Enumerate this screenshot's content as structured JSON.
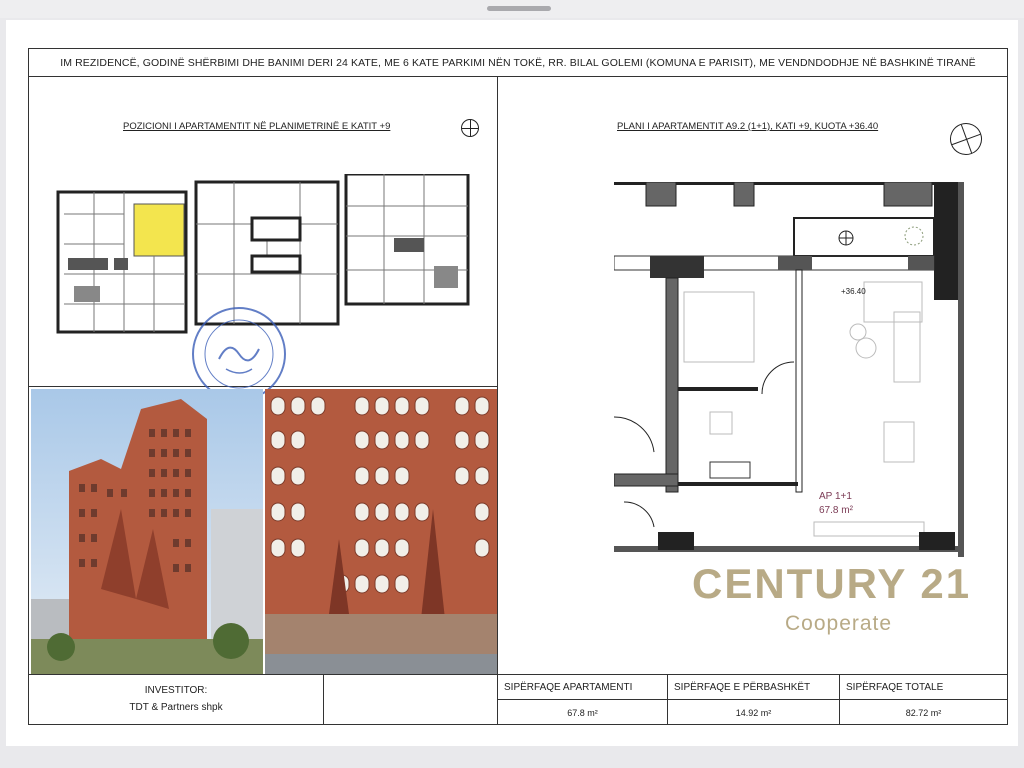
{
  "header": {
    "title": "IM REZIDENCË, GODINË SHËRBIMI DHE BANIMI DERI 24 KATE, ME 6 KATE PARKIMI NËN TOKË, RR. BILAL GOLEMI (KOMUNA E PARISIT), ME VENDNDODHJE NË BASHKINË TIRANË"
  },
  "left_panel": {
    "title": "POZICIONI I APARTAMENTIT NË PLANIMETRINË E KATIT +9"
  },
  "right_panel": {
    "title": "PLANI I APARTAMENTIT A9.2 (1+1), KATI +9, KUOTA +36.40",
    "level_label": "+36.40",
    "unit_label": "AP 1+1",
    "unit_area": "67.8 m²"
  },
  "footer": {
    "investor_label": "INVESTITOR:",
    "investor_name": "TDT & Partners shpk",
    "apt_area_label": "SIPËRFAQE APARTAMENTI",
    "apt_area_value": "67.8 m²",
    "shared_area_label": "SIPËRFAQE E PËRBASHKËT",
    "shared_area_value": "14.92 m²",
    "total_area_label": "SIPËRFAQE TOTALE",
    "total_area_value": "82.72 m²"
  },
  "watermark": {
    "brand": "CENTURY 21",
    "sub": "Cooperate"
  },
  "colors": {
    "highlight": "#f3e54e",
    "brick": "#b35a3f",
    "watermark": "#b8aa86",
    "stamp": "#3b5fb8"
  }
}
